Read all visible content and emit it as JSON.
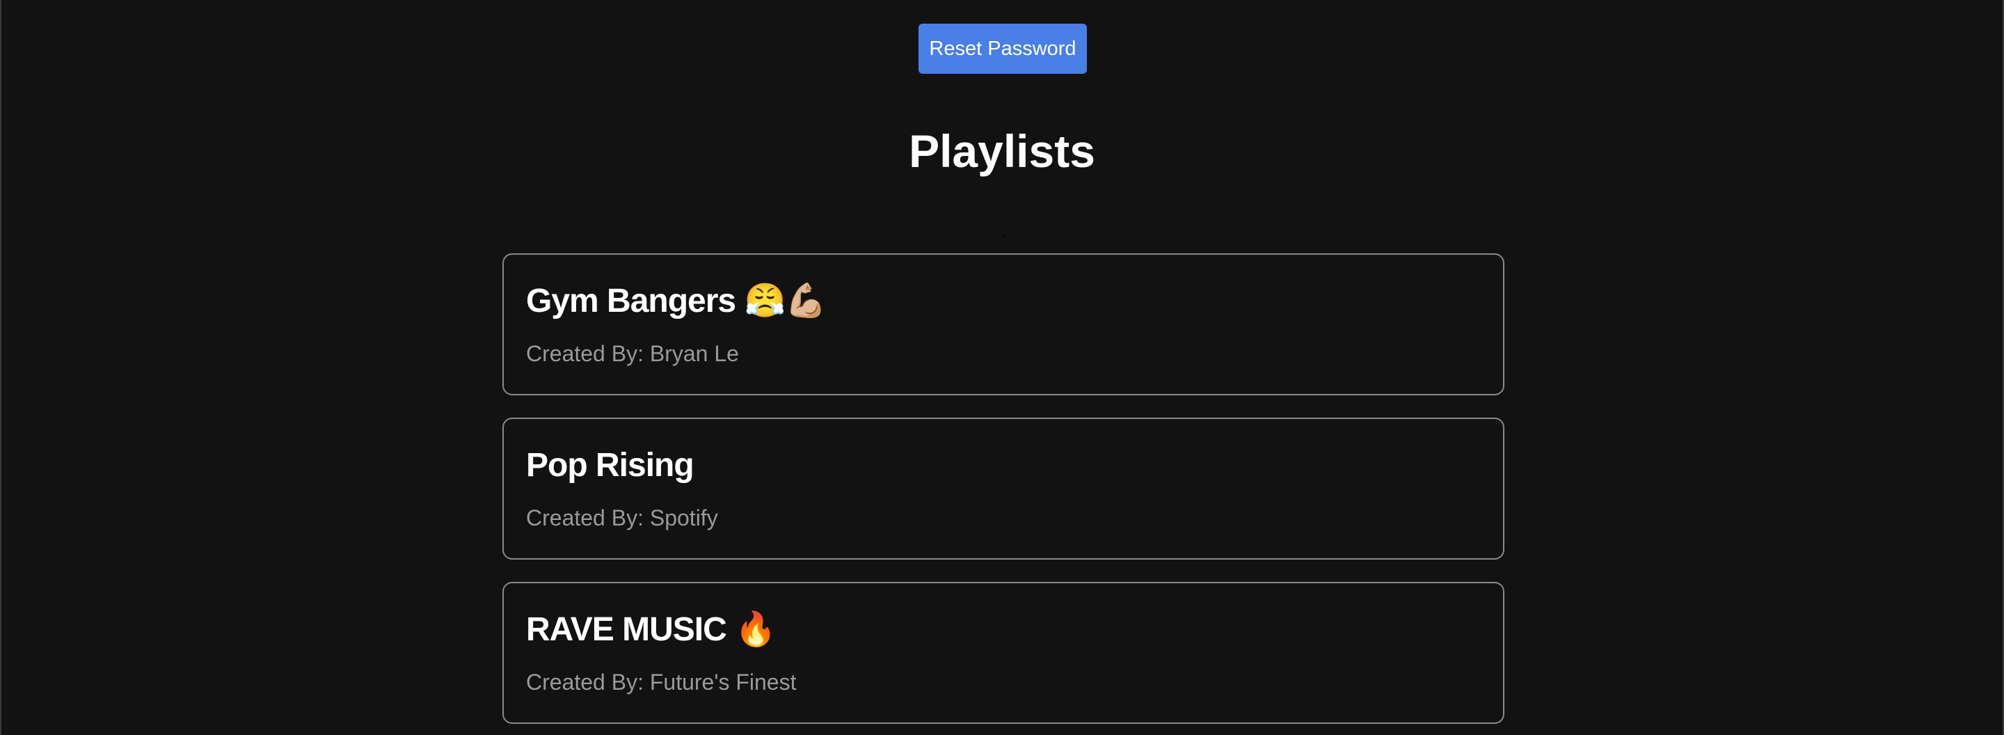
{
  "account": {
    "reset_password_label": "Reset Password"
  },
  "playlists_section": {
    "title": "Playlists",
    "items": [
      {
        "name": "Gym Bangers 😤💪🏼",
        "creator": "Created By: Bryan Le"
      },
      {
        "name": "Pop Rising",
        "creator": "Created By: Spotify"
      },
      {
        "name": "RAVE MUSIC 🔥",
        "creator": "Created By: Future's Finest"
      }
    ]
  },
  "colors": {
    "background": "#121212",
    "accent": "#4a7fe8",
    "card_border": "#8a8a8a",
    "secondary_text": "#9a9a9a"
  }
}
